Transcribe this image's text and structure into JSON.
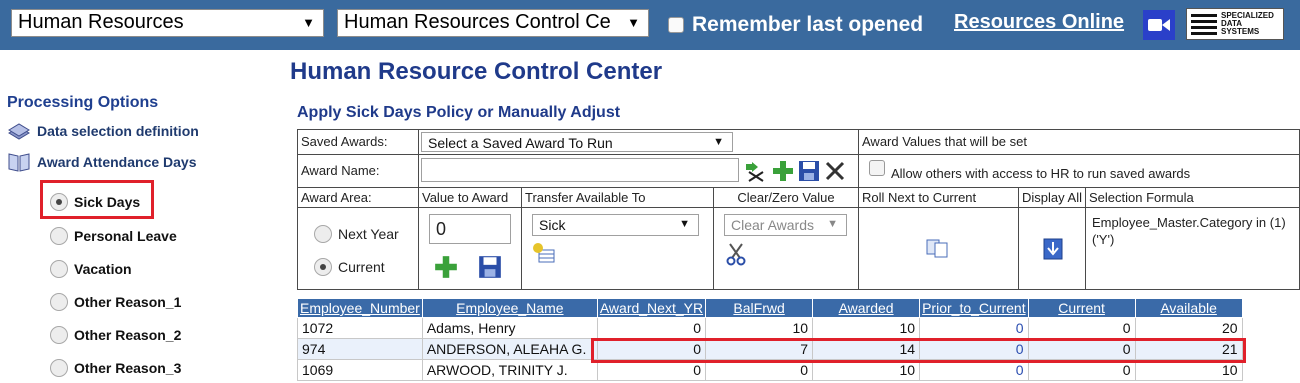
{
  "topbar": {
    "module_select": "Human Resources",
    "center_select": "Human Resources Control Ce",
    "remember_label": "Remember last opened",
    "resources_online": "Resources Online",
    "logo_text": [
      "SPECIALIZED",
      "DATA",
      "SYSTEMS"
    ]
  },
  "sidebar": {
    "title": "Processing Options",
    "links": [
      "Data selection definition",
      "Award Attendance Days"
    ],
    "options": [
      {
        "label": "Sick Days",
        "selected": true
      },
      {
        "label": "Personal Leave",
        "selected": false
      },
      {
        "label": "Vacation",
        "selected": false
      },
      {
        "label": "Other Reason_1",
        "selected": false
      },
      {
        "label": "Other Reason_2",
        "selected": false
      },
      {
        "label": "Other Reason_3",
        "selected": false
      }
    ]
  },
  "main": {
    "title": "Human Resource Control Center",
    "subtitle": "Apply Sick Days Policy or Manually Adjust"
  },
  "form": {
    "saved_awards_label": "Saved Awards:",
    "saved_awards_value": "Select a Saved Award To Run",
    "award_values_label": "Award Values that will be set",
    "award_name_label": "Award Name:",
    "award_name_value": "",
    "allow_others_label": "Allow others with access to HR to run saved awards",
    "award_area_label": "Award Area:",
    "value_to_award_label": "Value to Award",
    "transfer_label": "Transfer Available To",
    "clear_zero_label": "Clear/Zero Value",
    "roll_next_label": "Roll Next to Current",
    "display_all_label": "Display All",
    "selection_formula_label": "Selection Formula",
    "area_next_year": "Next Year",
    "area_current": "Current",
    "value_to_award": "0",
    "transfer_value": "Sick",
    "clear_awards_value": "Clear Awards",
    "selection_formula": "Employee_Master.Category in (1) ('Y')"
  },
  "table": {
    "columns": [
      "Employee_Number",
      "Employee_Name",
      "Award_Next_YR",
      "BalFrwd",
      "Awarded",
      "Prior_to_Current",
      "Current",
      "Available"
    ],
    "rows": [
      [
        "1072",
        "Adams, Henry",
        "0",
        "10",
        "10",
        "0",
        "0",
        "20"
      ],
      [
        "974",
        "ANDERSON, ALEAHA G.",
        "0",
        "7",
        "14",
        "0",
        "0",
        "21"
      ],
      [
        "1069",
        "ARWOOD, TRINITY J.",
        "0",
        "0",
        "10",
        "0",
        "0",
        "10"
      ]
    ]
  },
  "colors": {
    "topbar": "#3a6a9e",
    "heading": "#1f3a8a",
    "table_header": "#3a6aa8",
    "highlight": "#e0202a"
  }
}
